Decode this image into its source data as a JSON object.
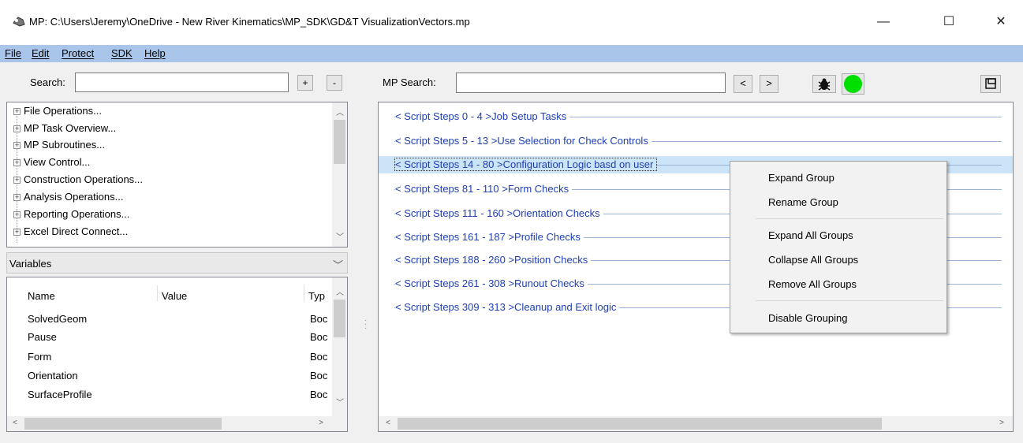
{
  "window": {
    "title": "MP: C:\\Users\\Jeremy\\OneDrive - New River Kinematics\\MP_SDK\\GD&T VisualizationVectors.mp",
    "icon": "app-icon",
    "min_glyph": "—",
    "max_glyph": "☐",
    "close_glyph": "✕"
  },
  "menu": {
    "file": "File",
    "edit": "Edit",
    "protect": "Protect",
    "sdk": "SDK",
    "help": "Help"
  },
  "left": {
    "search_label": "Search:",
    "search_value": "",
    "plus_label": "+",
    "minus_label": "-",
    "tree_items": [
      "File Operations...",
      "MP Task Overview...",
      "MP Subroutines...",
      "View Control...",
      "Construction Operations...",
      "Analysis Operations...",
      "Reporting Operations...",
      "Excel Direct Connect..."
    ],
    "variables_dropdown": "Variables",
    "grid_headers": [
      "Name",
      "Value",
      "Typ"
    ],
    "grid_rows": [
      {
        "name": "SolvedGeom",
        "value": "",
        "type": "Boc"
      },
      {
        "name": "Pause",
        "value": "",
        "type": "Boc"
      },
      {
        "name": "Form",
        "value": "",
        "type": "Boc"
      },
      {
        "name": "Orientation",
        "value": "",
        "type": "Boc"
      },
      {
        "name": "SurfaceProfile",
        "value": "",
        "type": "Boc"
      }
    ]
  },
  "right": {
    "mp_search_label": "MP Search:",
    "mp_search_value": "",
    "prev_label": "<",
    "next_label": ">",
    "bug_icon": "bug-icon",
    "status_color": "#00e000",
    "groups": [
      "< Script Steps 0 - 4 >Job Setup Tasks",
      "< Script Steps 5 - 13 >Use Selection for Check Controls",
      "< Script Steps 14 - 80 >Configuration Logic basd on user",
      "< Script Steps 81 - 110 >Form Checks",
      "< Script Steps 111 - 160 >Orientation Checks",
      "< Script Steps 161 - 187 >Profile Checks",
      "< Script Steps 188 - 260 >Position Checks",
      "< Script Steps 261 - 308 >Runout Checks",
      "< Script Steps 309 - 313 >Cleanup and Exit logic"
    ],
    "selected_group_index": 2
  },
  "context_menu": {
    "expand_group": "Expand Group",
    "rename_group": "Rename Group",
    "expand_all": "Expand All Groups",
    "collapse_all": "Collapse All Groups",
    "remove_all": "Remove All Groups",
    "disable_grouping": "Disable Grouping"
  }
}
